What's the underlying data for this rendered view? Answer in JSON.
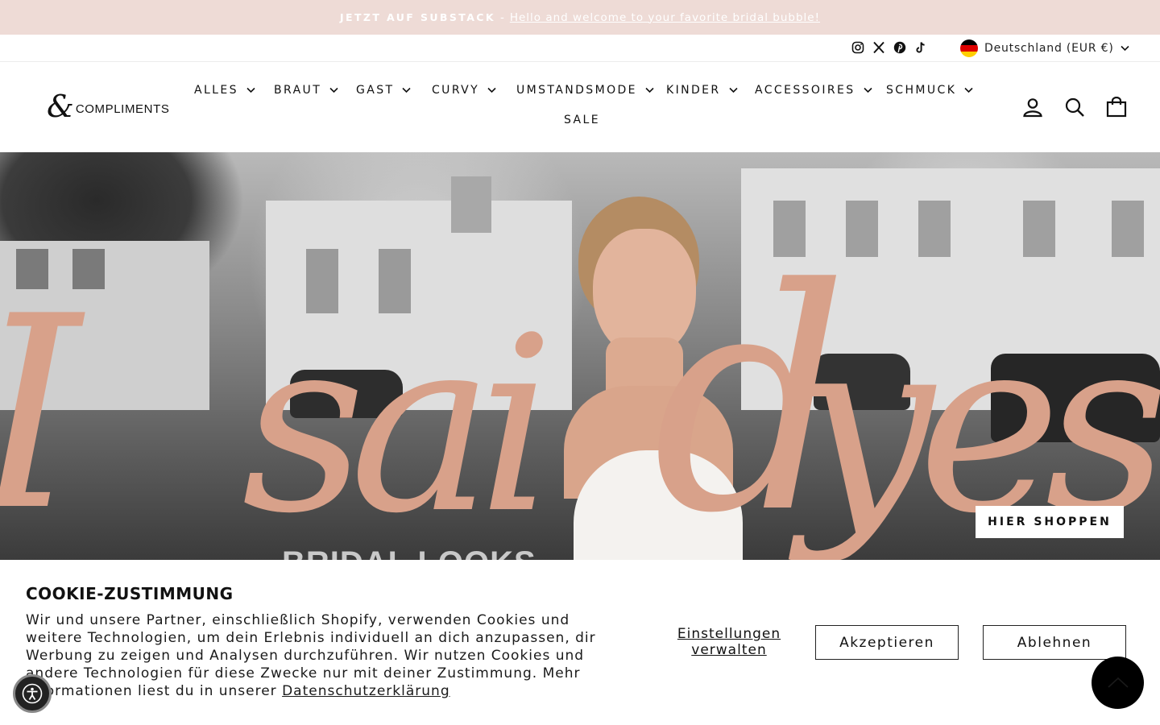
{
  "announcement": {
    "label": "JETZT AUF SUBSTACK",
    "separator": "-",
    "link_text": "Hello and welcome to your favorite bridal bubble!"
  },
  "social": [
    "instagram-icon",
    "x-icon",
    "pinterest-icon",
    "tiktok-icon"
  ],
  "locale": {
    "label": "Deutschland (EUR €)",
    "flag_colors": [
      "#000000",
      "#dd0000",
      "#ffce00"
    ]
  },
  "logo": {
    "ampersand": "&",
    "word": "COMPLIMENTS"
  },
  "nav": {
    "items": [
      {
        "label": "ALLES"
      },
      {
        "label": "BRAUT"
      },
      {
        "label": "GAST"
      },
      {
        "label": "CURVY"
      },
      {
        "label": "UMSTANDSMODE"
      },
      {
        "label": "KINDER"
      },
      {
        "label": "ACCESSOIRES"
      },
      {
        "label": "SCHMUCK"
      }
    ],
    "sale": "SALE"
  },
  "header_icons": [
    "account-icon",
    "search-icon",
    "cart-icon"
  ],
  "hero": {
    "script_text": "I said yes",
    "subtitle": "BRIDAL LOOKS",
    "cta": "HIER SHOPPEN",
    "script_color": "#d8a18a"
  },
  "cookie": {
    "title": "COOKIE-ZUSTIMMUNG",
    "body": "Wir und unsere Partner, einschließlich Shopify, verwenden Cookies und weitere Technologien, um dein Erlebnis individuell an dich anzupassen, dir Werbung zu zeigen und Analysen durchzuführen. Wir nutzen Cookies und andere Technologien für diese Zwecke nur mit deiner Zustimmung. Mehr Informationen liest du in unserer",
    "privacy_link": "Datenschutzerklärung",
    "manage": "Einstellungen verwalten",
    "accept": "Akzeptieren",
    "decline": "Ablehnen"
  },
  "colors": {
    "announcement_bg": "#eedbd6",
    "text": "#111111"
  }
}
